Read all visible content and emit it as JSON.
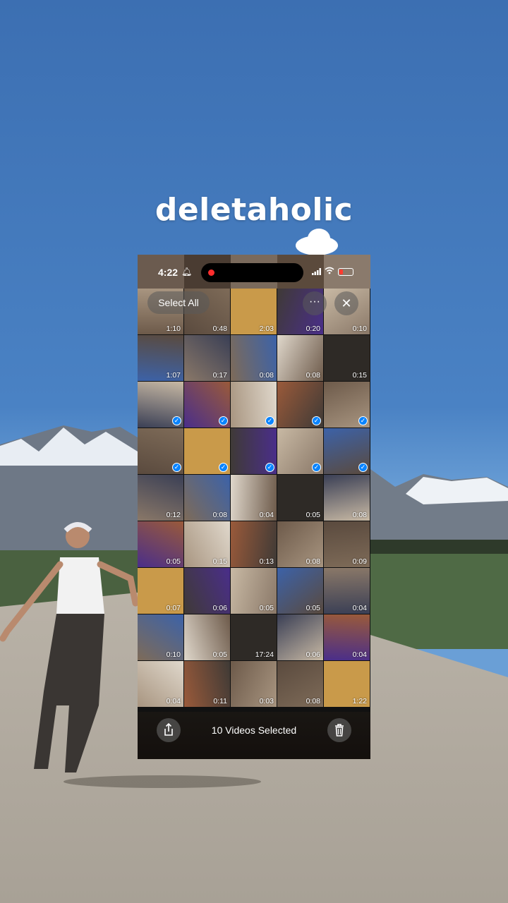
{
  "caption": "deletaholic",
  "status_bar": {
    "time": "4:22"
  },
  "toolbar": {
    "select_all": "Select All",
    "more": "···",
    "close": "✕"
  },
  "bottom_bar": {
    "label": "10 Videos Selected"
  },
  "colors": {
    "accent": "#0a84ff",
    "sky": "#3f73b6",
    "record": "#ff2d2d"
  },
  "tiles": [
    {
      "dur": "1:10",
      "sel": false
    },
    {
      "dur": "0:48",
      "sel": false
    },
    {
      "dur": "2:03",
      "sel": false
    },
    {
      "dur": "0:20",
      "sel": false
    },
    {
      "dur": "0:10",
      "sel": false
    },
    {
      "dur": "1:07",
      "sel": false
    },
    {
      "dur": "0:17",
      "sel": false
    },
    {
      "dur": "0:08",
      "sel": false
    },
    {
      "dur": "0:08",
      "sel": false
    },
    {
      "dur": "0:15",
      "sel": false
    },
    {
      "dur": "",
      "sel": true
    },
    {
      "dur": "",
      "sel": true
    },
    {
      "dur": "",
      "sel": true
    },
    {
      "dur": "",
      "sel": true
    },
    {
      "dur": "",
      "sel": true
    },
    {
      "dur": "",
      "sel": true
    },
    {
      "dur": "",
      "sel": true
    },
    {
      "dur": "",
      "sel": true
    },
    {
      "dur": "",
      "sel": true
    },
    {
      "dur": "",
      "sel": true
    },
    {
      "dur": "0:12",
      "sel": false
    },
    {
      "dur": "0:08",
      "sel": false
    },
    {
      "dur": "0:04",
      "sel": false
    },
    {
      "dur": "0:05",
      "sel": false
    },
    {
      "dur": "0:08",
      "sel": false
    },
    {
      "dur": "0:05",
      "sel": false
    },
    {
      "dur": "0:15",
      "sel": false
    },
    {
      "dur": "0:13",
      "sel": false
    },
    {
      "dur": "0:08",
      "sel": false
    },
    {
      "dur": "0:09",
      "sel": false
    },
    {
      "dur": "0:07",
      "sel": false
    },
    {
      "dur": "0:06",
      "sel": false
    },
    {
      "dur": "0:05",
      "sel": false
    },
    {
      "dur": "0:05",
      "sel": false
    },
    {
      "dur": "0:04",
      "sel": false
    },
    {
      "dur": "0:10",
      "sel": false
    },
    {
      "dur": "0:05",
      "sel": false
    },
    {
      "dur": "17:24",
      "sel": false
    },
    {
      "dur": "0:06",
      "sel": false
    },
    {
      "dur": "0:04",
      "sel": false
    },
    {
      "dur": "0:04",
      "sel": false
    },
    {
      "dur": "0:11",
      "sel": false
    },
    {
      "dur": "0:03",
      "sel": false
    },
    {
      "dur": "0:08",
      "sel": false
    },
    {
      "dur": "1:22",
      "sel": false
    }
  ]
}
